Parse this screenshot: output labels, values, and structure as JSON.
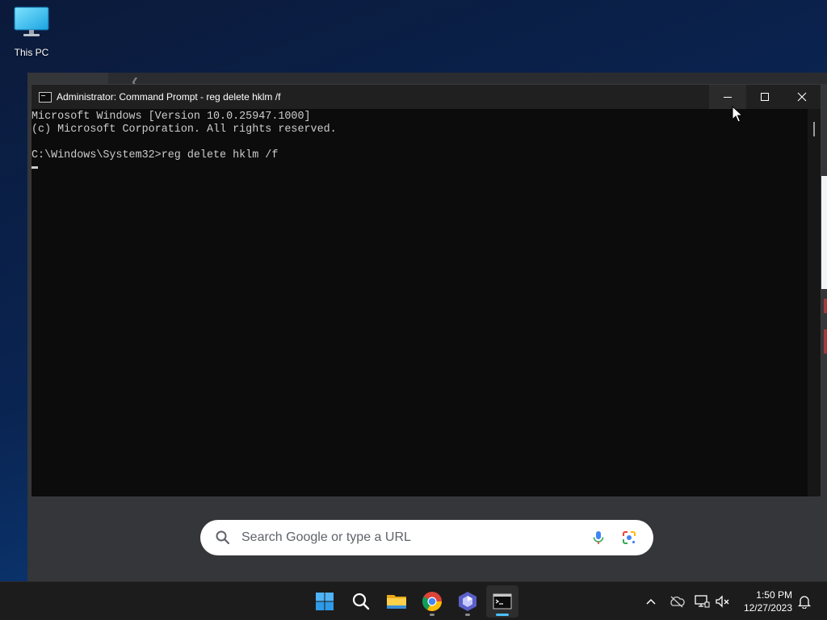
{
  "desktop": {
    "icons": [
      {
        "label": "This PC",
        "icon": "monitor-icon"
      }
    ]
  },
  "browser_background": {
    "omnibox_placeholder": "Search Google or type a URL"
  },
  "cmd_window": {
    "title": "Administrator: Command Prompt - reg  delete hklm /f",
    "lines": [
      "Microsoft Windows [Version 10.0.25947.1000]",
      "(c) Microsoft Corporation. All rights reserved.",
      "",
      "C:\\Windows\\System32>reg delete hklm /f"
    ],
    "controls": [
      "minimize-icon",
      "maximize-icon",
      "close-icon"
    ]
  },
  "taskbar": {
    "apps": [
      {
        "name": "Start",
        "icon": "windows-start-icon"
      },
      {
        "name": "Search",
        "icon": "search-icon"
      },
      {
        "name": "File Explorer",
        "icon": "folder-icon"
      },
      {
        "name": "Google Chrome",
        "icon": "chrome-icon"
      },
      {
        "name": "App",
        "icon": "hexagon-app-icon"
      },
      {
        "name": "Command Prompt",
        "icon": "terminal-icon"
      }
    ],
    "tray": [
      "chevron-up-icon",
      "onedrive-offline-icon",
      "network-icon",
      "volume-muted-icon"
    ],
    "clock_time": "1:50 PM",
    "clock_date": "12/27/2023",
    "notification_icon": "bell-icon"
  },
  "colors": {
    "accent": "#4cc2ff",
    "terminal_bg": "#0c0c0c",
    "terminal_fg": "#cccccc",
    "taskbar_bg": "#1c1c1c"
  }
}
